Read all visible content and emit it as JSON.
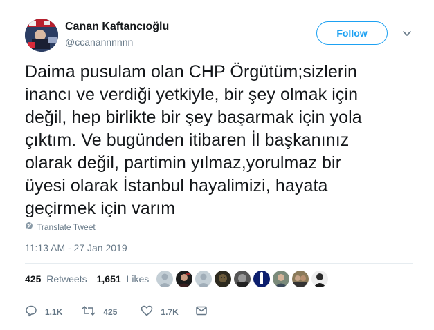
{
  "author": {
    "name": "Canan Kaftancıoğlu",
    "handle": "@ccanannnnnn"
  },
  "follow_button": {
    "label": "Follow",
    "color": "#1da1f2"
  },
  "tweet": {
    "text": "Daima pusulam olan CHP Örgütüm;sizlerin\ninancı ve verdiği yetkiyle, bir şey olmak için\ndeğil, hep birlikte bir şey başarmak için yola\nçıktım. Ve bugünden itibaren İl başkanınız\nolarak değil, partimin yılmaz,yorulmaz bir\nüyesi olarak İstanbul hayalimizi, hayata\ngeçirmek için varım",
    "translate_label": "Translate Tweet",
    "timestamp": "11:13 AM - 27 Jan 2019"
  },
  "stats": {
    "retweets_count": "425",
    "retweets_label": "Retweets",
    "likes_count": "1,651",
    "likes_label": "Likes"
  },
  "actions": {
    "reply_count": "1.1K",
    "retweet_count": "425",
    "like_count": "1.7K"
  },
  "icons": {
    "globe": "globe-icon",
    "caret": "chevron-down-icon",
    "reply": "reply-icon",
    "retweet": "retweet-icon",
    "like": "heart-icon",
    "dm": "envelope-icon"
  },
  "colors": {
    "text": "#14171a",
    "secondary": "#657786",
    "accent": "#1da1f2",
    "divider": "#e6ecf0"
  }
}
